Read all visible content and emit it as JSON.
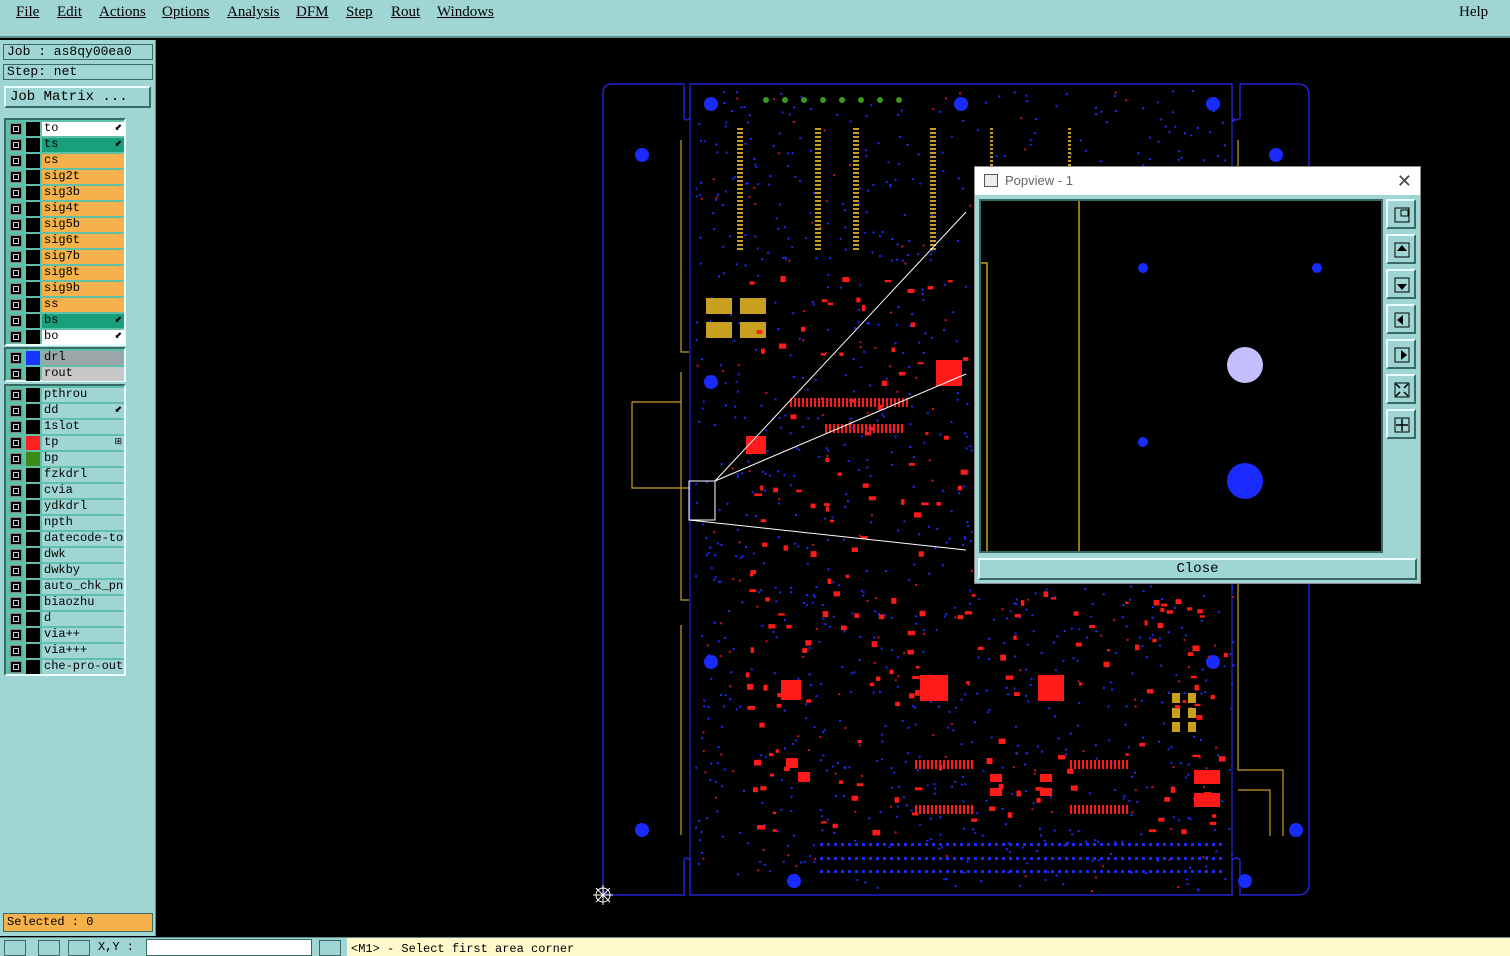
{
  "menu": {
    "file": "File",
    "edit": "Edit",
    "actions": "Actions",
    "options": "Options",
    "analysis": "Analysis",
    "dfm": "DFM",
    "step": "Step",
    "rout": "Rout",
    "windows": "Windows",
    "help": "Help"
  },
  "job": {
    "job_line": "Job : as8qy00ea0",
    "step_line": "Step: net",
    "matrix_button": "Job Matrix ..."
  },
  "layers_board": [
    {
      "name": "to",
      "bg": "#ffffff",
      "mark": "⬋"
    },
    {
      "name": "ts",
      "bg": "#17a07a",
      "mark": "⬋"
    },
    {
      "name": "cs",
      "bg": "#f5b24a",
      "mark": ""
    },
    {
      "name": "sig2t",
      "bg": "#f5b24a",
      "mark": ""
    },
    {
      "name": "sig3b",
      "bg": "#f5b24a",
      "mark": ""
    },
    {
      "name": "sig4t",
      "bg": "#f5b24a",
      "mark": ""
    },
    {
      "name": "sig5b",
      "bg": "#f5b24a",
      "mark": ""
    },
    {
      "name": "sig6t",
      "bg": "#f5b24a",
      "mark": ""
    },
    {
      "name": "sig7b",
      "bg": "#f5b24a",
      "mark": ""
    },
    {
      "name": "sig8t",
      "bg": "#f5b24a",
      "mark": ""
    },
    {
      "name": "sig9b",
      "bg": "#f5b24a",
      "mark": ""
    },
    {
      "name": "ss",
      "bg": "#f5b24a",
      "mark": ""
    },
    {
      "name": "bs",
      "bg": "#17a07a",
      "mark": "⬋"
    },
    {
      "name": "bo",
      "bg": "#ffffff",
      "mark": "⬋"
    }
  ],
  "layers_drill": [
    {
      "name": "drl",
      "bg": "#9aa6a8",
      "color": "#1a33ff",
      "mark": ""
    },
    {
      "name": "rout",
      "bg": "#c8c8c8",
      "color": "#000000",
      "mark": ""
    }
  ],
  "layers_misc": [
    {
      "name": "pthrou",
      "color": "#000000",
      "mark": ""
    },
    {
      "name": "dd",
      "color": "#000000",
      "mark": "⬋"
    },
    {
      "name": "1slot",
      "color": "#000000",
      "mark": ""
    },
    {
      "name": "tp",
      "color": "#ff2020",
      "mark": "⊞"
    },
    {
      "name": "bp",
      "color": "#3a8a1a",
      "mark": ""
    },
    {
      "name": "fzkdrl",
      "color": "#000000",
      "mark": ""
    },
    {
      "name": "cvia",
      "color": "#000000",
      "mark": ""
    },
    {
      "name": "ydkdrl",
      "color": "#000000",
      "mark": ""
    },
    {
      "name": "npth",
      "color": "#000000",
      "mark": ""
    },
    {
      "name": "datecode-to",
      "color": "#000000",
      "mark": ""
    },
    {
      "name": "dwk",
      "color": "#000000",
      "mark": ""
    },
    {
      "name": "dwkby",
      "color": "#000000",
      "mark": ""
    },
    {
      "name": "auto_chk_pn",
      "color": "#000000",
      "mark": ""
    },
    {
      "name": "biaozhu",
      "color": "#000000",
      "mark": ""
    },
    {
      "name": "d",
      "color": "#000000",
      "mark": ""
    },
    {
      "name": "via++",
      "color": "#000000",
      "mark": ""
    },
    {
      "name": "via+++",
      "color": "#000000",
      "mark": ""
    },
    {
      "name": "che-pro-out",
      "color": "#000000",
      "mark": ""
    }
  ],
  "status": {
    "selected": "Selected : 0",
    "xy_label": "X,Y :",
    "xy_value": "",
    "prompt": "<M1> - Select first area corner"
  },
  "popview": {
    "title": "Popview - 1",
    "close_label": "Close"
  },
  "colors": {
    "panel": "#9fd6d4",
    "signal": "#f5b24a",
    "pad": "#ff1a1a",
    "via": "#1a2bff",
    "outline": "#2a2aff",
    "rout": "#c8a020"
  }
}
